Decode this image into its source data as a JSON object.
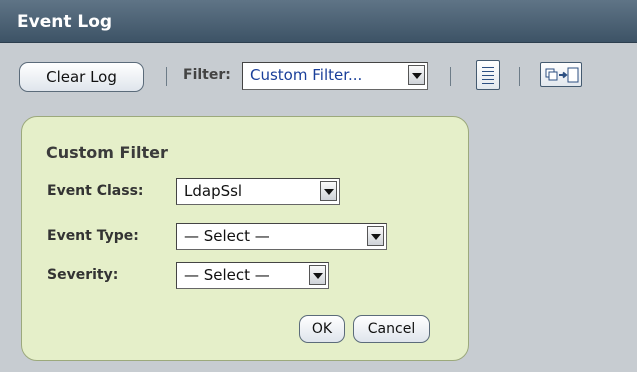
{
  "window": {
    "title": "Event Log"
  },
  "toolbar": {
    "clear_label": "Clear Log",
    "filter_label": "Filter:",
    "filter_value": "Custom Filter...",
    "icons": [
      "document-view-icon",
      "move-copy-icon"
    ]
  },
  "custom_filter": {
    "title": "Custom Filter",
    "event_class": {
      "label": "Event Class:",
      "value": "LdapSsl"
    },
    "event_type": {
      "label": "Event Type:",
      "value": "— Select —"
    },
    "severity": {
      "label": "Severity:",
      "value": "— Select —"
    },
    "ok_label": "OK",
    "cancel_label": "Cancel"
  },
  "colors": {
    "titlebar": "#4b6073",
    "panel_bg": "#e5efc9",
    "page_bg": "#c7ccd1",
    "filter_text": "#1a3f9a"
  }
}
